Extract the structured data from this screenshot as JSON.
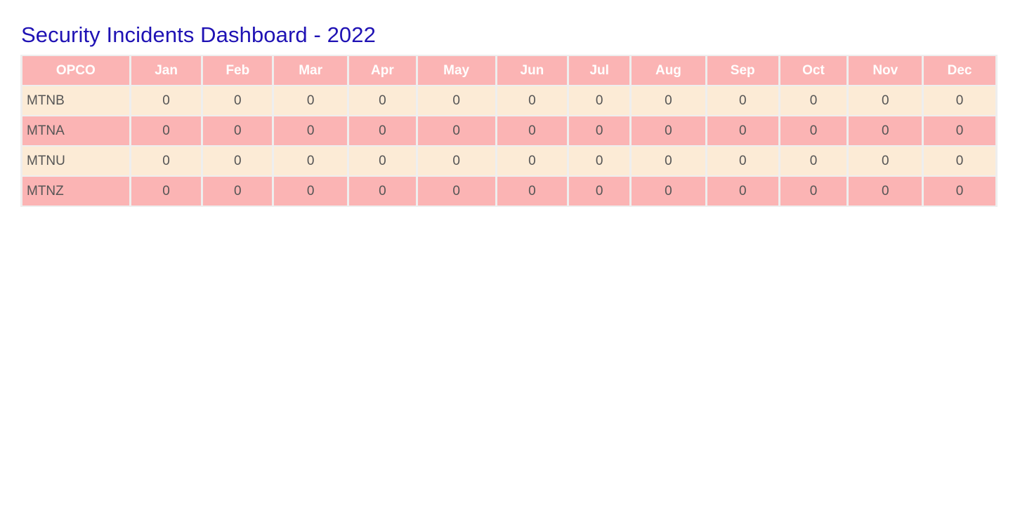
{
  "title": "Security Incidents Dashboard - 2022",
  "colors": {
    "title": "#1f12b4",
    "header_bg": "#fbb4b4",
    "header_text": "#ffffff",
    "row_light": "#fcebd6",
    "row_pink": "#fbb4b4",
    "cell_text": "#555555",
    "grid": "#eeeeee"
  },
  "table": {
    "headers": [
      "OPCO",
      "Jan",
      "Feb",
      "Mar",
      "Apr",
      "May",
      "Jun",
      "Jul",
      "Aug",
      "Sep",
      "Oct",
      "Nov",
      "Dec"
    ],
    "rows": [
      {
        "opco": "MTNB",
        "values": [
          "0",
          "0",
          "0",
          "0",
          "0",
          "0",
          "0",
          "0",
          "0",
          "0",
          "0",
          "0"
        ]
      },
      {
        "opco": "MTNA",
        "values": [
          "0",
          "0",
          "0",
          "0",
          "0",
          "0",
          "0",
          "0",
          "0",
          "0",
          "0",
          "0"
        ]
      },
      {
        "opco": "MTNU",
        "values": [
          "0",
          "0",
          "0",
          "0",
          "0",
          "0",
          "0",
          "0",
          "0",
          "0",
          "0",
          "0"
        ]
      },
      {
        "opco": "MTNZ",
        "values": [
          "0",
          "0",
          "0",
          "0",
          "0",
          "0",
          "0",
          "0",
          "0",
          "0",
          "0",
          "0"
        ]
      }
    ]
  }
}
